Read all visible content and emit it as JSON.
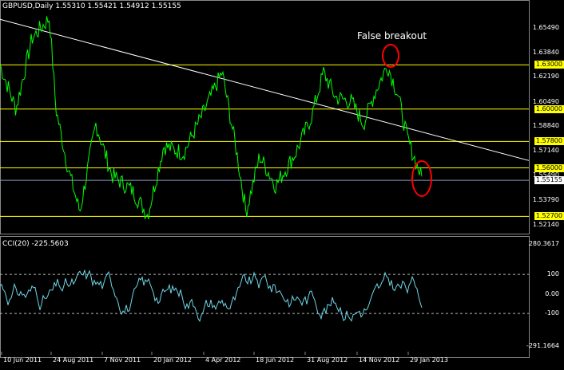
{
  "header": {
    "symbol_tf": "GBPUSD,Daily",
    "ohlc": "1.55310 1.55421 1.54912 1.55155"
  },
  "annotation": "False breakout",
  "cci": {
    "title": "CCI(20) -225.5603",
    "axis_labels": [
      "280.3617",
      "100",
      "0.00",
      "-100",
      "-291.1664"
    ],
    "axis_values": [
      280.3617,
      100,
      0,
      -100,
      -291.1664
    ]
  },
  "price_axis": {
    "labels": [
      "1.65490",
      "1.63840",
      "1.62190",
      "1.60490",
      "1.58840",
      "1.57140",
      "1.55490",
      "1.53790",
      "1.52140"
    ],
    "values": [
      1.6549,
      1.6384,
      1.6219,
      1.6049,
      1.5884,
      1.5714,
      1.5549,
      1.5379,
      1.5214
    ],
    "min": 1.518,
    "max": 1.666
  },
  "levels": [
    {
      "label": "1.63000",
      "value": 1.63
    },
    {
      "label": "1.60000",
      "value": 1.6
    },
    {
      "label": "1.57800",
      "value": 1.578
    },
    {
      "label": "1.56000",
      "value": 1.56
    },
    {
      "label": "1.52700",
      "value": 1.527
    }
  ],
  "current_price": {
    "label": "1.55155",
    "value": 1.55155
  },
  "date_axis": [
    "10 Jun 2011",
    "24 Aug 2011",
    "7 Nov 2011",
    "20 Jan 2012",
    "4 Apr 2012",
    "18 Jun 2012",
    "31 Aug 2012",
    "14 Nov 2012",
    "29 Jan 2013"
  ],
  "colors": {
    "price": "#00ff00",
    "cci": "#6fd6e6",
    "level": "#ffff00",
    "trendline": "#ffffff",
    "marker": "#ff0000",
    "background": "#000000"
  },
  "chart_data": {
    "type": "line",
    "price_series": {
      "name": "GBPUSD",
      "x": [
        "10 Jun 2011",
        "24 Aug 2011",
        "7 Nov 2011",
        "20 Jan 2012",
        "4 Apr 2012",
        "18 Jun 2012",
        "31 Aug 2012",
        "14 Nov 2012",
        "29 Jan 2013"
      ],
      "y": [
        1.638,
        1.655,
        1.545,
        1.555,
        1.62,
        1.545,
        1.615,
        1.623,
        1.558
      ]
    },
    "trendline": {
      "from": {
        "x": "10 Jun 2011",
        "y": 1.661
      },
      "to": {
        "x": "29 Jan 2013",
        "y": 1.591
      }
    },
    "false_breakout": {
      "x": "14 Nov 2012",
      "y": 1.633
    },
    "breakdown": {
      "x": "29 Jan 2013",
      "y": 1.553
    }
  }
}
